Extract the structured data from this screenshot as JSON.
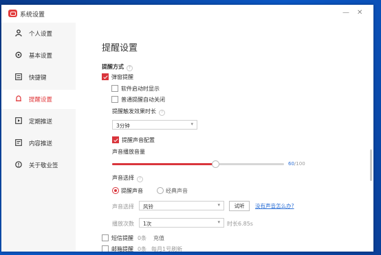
{
  "window": {
    "title": "系统设置",
    "minimize": "—",
    "close": "✕"
  },
  "sidebar": {
    "items": [
      {
        "label": "个人设置",
        "icon": "user-icon"
      },
      {
        "label": "基本设置",
        "icon": "gear-icon"
      },
      {
        "label": "快捷键",
        "icon": "keyboard-icon"
      },
      {
        "label": "提醒设置",
        "icon": "bell-icon",
        "active": true
      },
      {
        "label": "定期推送",
        "icon": "schedule-icon"
      },
      {
        "label": "内容推送",
        "icon": "document-icon"
      },
      {
        "label": "关于敬业签",
        "icon": "info-icon"
      }
    ]
  },
  "main": {
    "title": "提醒设置",
    "method_heading": "提醒方式",
    "popup": {
      "label": "弹窗提醒",
      "checked": true
    },
    "popup_on_start": {
      "label": "软件启动时显示",
      "checked": false
    },
    "auto_close": {
      "label": "普通提醒自动关闭",
      "checked": false
    },
    "duration": {
      "label": "提醒触发效果时长",
      "value": "3分钟"
    },
    "sound": {
      "label": "提醒声音配置",
      "checked": true
    },
    "volume": {
      "label": "声音播放音量",
      "value": "60",
      "max": "/100",
      "percent": 60
    },
    "sound_choice": {
      "label": "声音选择",
      "options": [
        {
          "label": "提醒声音",
          "selected": true
        },
        {
          "label": "经典声音",
          "selected": false
        }
      ]
    },
    "sound_select": {
      "label": "声音选择",
      "value": "风铃",
      "try_button": "试听",
      "link": "没有声音怎么办?"
    },
    "play_count": {
      "label": "播放次数",
      "value": "1次",
      "duration": "时长6.85s"
    },
    "sms": {
      "label": "短信提醒",
      "count": "0条",
      "action": "充值",
      "checked": false
    },
    "email": {
      "label": "邮箱提醒",
      "count": "0条",
      "note": "每月1号刷新",
      "checked": false
    }
  },
  "colors": {
    "accent": "#d9353c",
    "link": "#2b6fd6",
    "sidebar_bg": "#f6f6f6"
  }
}
